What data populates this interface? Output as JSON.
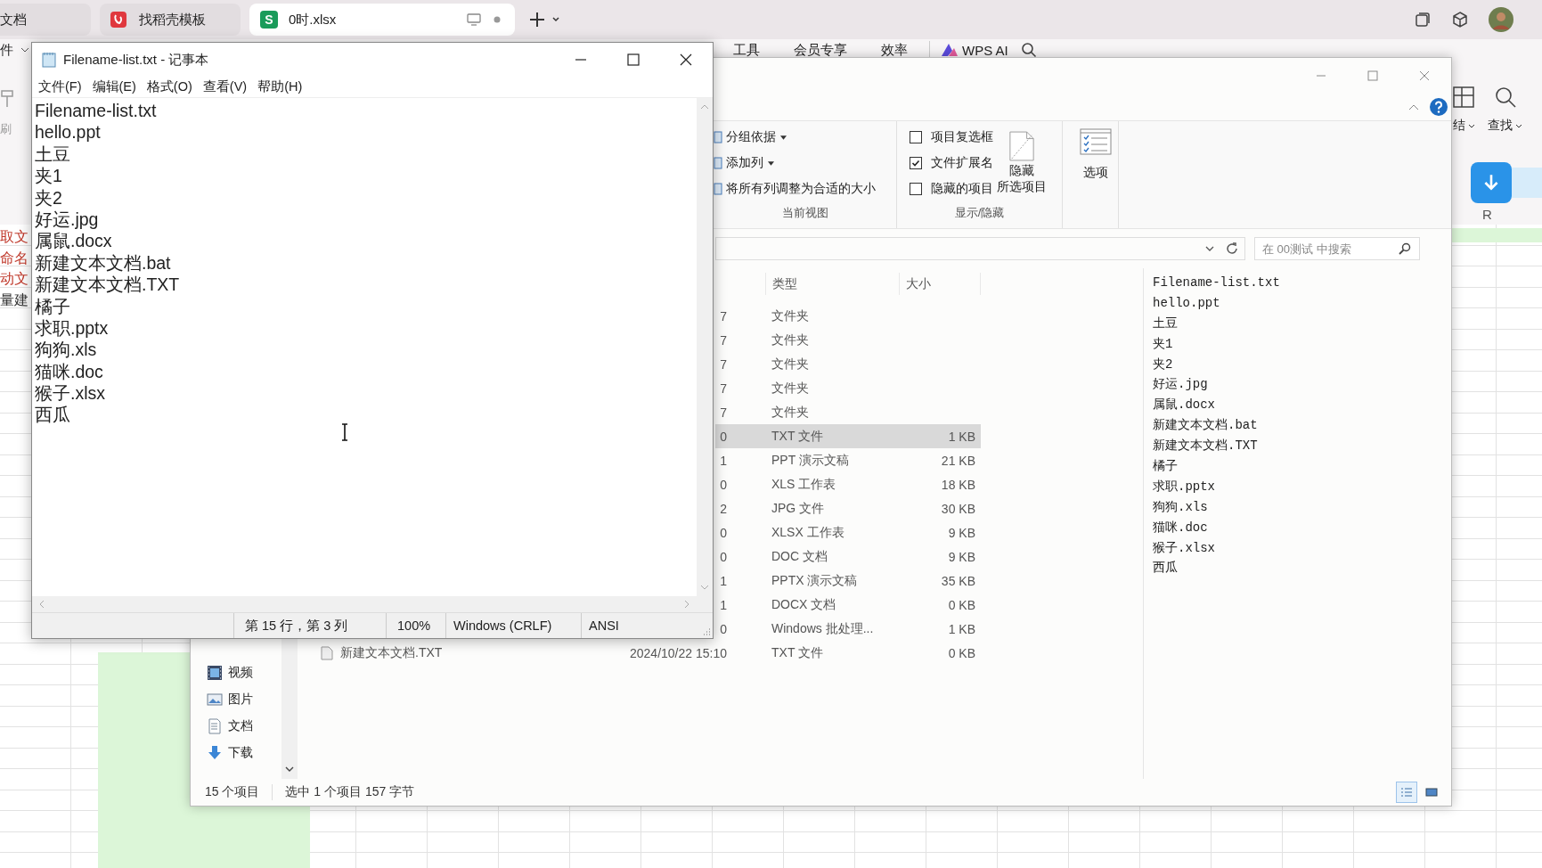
{
  "wps": {
    "tabs": [
      {
        "label": "文档",
        "selected": false,
        "kind": "doc"
      },
      {
        "label": "找稻壳模板",
        "selected": false,
        "kind": "template"
      },
      {
        "label": "0时.xlsx",
        "selected": true,
        "kind": "sheet",
        "icon_text": "S"
      }
    ],
    "menu_cut": "件",
    "menu": [
      "工具",
      "会员专享",
      "效率"
    ],
    "ai_label": "WPS AI",
    "toolbar_left": "刷",
    "toolbar_right": [
      "结",
      "查找"
    ],
    "sheet": {
      "column_header": "R",
      "cells": [
        {
          "text": "取文",
          "color": "#c0392b"
        },
        {
          "text": "命名",
          "color": "#c0392b"
        },
        {
          "text": "动文",
          "color": "#c0392b"
        },
        {
          "text": "量建",
          "color": "#333333"
        }
      ]
    }
  },
  "explorer": {
    "current_view": {
      "label": "当前视图",
      "items": [
        {
          "label": "分组依据",
          "dropdown": true
        },
        {
          "label": "添加列",
          "dropdown": true
        },
        {
          "label": "将所有列调整为合适的大小",
          "dropdown": false
        }
      ]
    },
    "show_hide": {
      "label": "显示/隐藏",
      "checkboxes": [
        {
          "label": "项目复选框",
          "checked": false
        },
        {
          "label": "文件扩展名",
          "checked": true
        },
        {
          "label": "隐藏的项目",
          "checked": false
        }
      ],
      "hide_selected": [
        "隐藏",
        "所选项目"
      ]
    },
    "options": "选项",
    "search": {
      "placeholder": "在 00测试 中搜索"
    },
    "columns": [
      "类型",
      "大小"
    ],
    "rows": [
      {
        "date": "7",
        "type": "文件夹",
        "selected": false
      },
      {
        "date": "7",
        "type": "文件夹",
        "selected": false
      },
      {
        "date": "7",
        "type": "文件夹",
        "selected": false
      },
      {
        "date": "7",
        "type": "文件夹",
        "selected": false
      },
      {
        "date": "7",
        "type": "文件夹",
        "selected": false
      },
      {
        "date": "0",
        "type": "TXT 文件",
        "size": "1 KB",
        "selected": true
      },
      {
        "date": "1",
        "type": "PPT 演示文稿",
        "size": "21 KB",
        "selected": false
      },
      {
        "date": "0",
        "type": "XLS 工作表",
        "size": "18 KB",
        "selected": false
      },
      {
        "date": "2",
        "type": "JPG 文件",
        "size": "30 KB",
        "selected": false
      },
      {
        "date": "0",
        "type": "XLSX 工作表",
        "size": "9 KB",
        "selected": false
      },
      {
        "date": "0",
        "type": "DOC 文档",
        "size": "9 KB",
        "selected": false
      },
      {
        "date": "1",
        "type": "PPTX 演示文稿",
        "size": "35 KB",
        "selected": false
      },
      {
        "date": "1",
        "type": "DOCX 文档",
        "size": "0 KB",
        "selected": false
      },
      {
        "date": "0",
        "type": "Windows 批处理...",
        "size": "1 KB",
        "selected": false
      },
      {
        "name": "新建文本文档.TXT",
        "date": "2024/10/22 15:10",
        "type": "TXT 文件",
        "size": "0 KB",
        "selected": false
      }
    ],
    "preview": [
      "Filename-list.txt",
      "hello.ppt",
      "土豆",
      "夹1",
      "夹2",
      "好运.jpg",
      "属鼠.docx",
      "新建文本文档.bat",
      "新建文本文档.TXT",
      "橘子",
      "求职.pptx",
      "狗狗.xls",
      "猫咪.doc",
      "猴子.xlsx",
      "西瓜"
    ],
    "nav": [
      {
        "label": "视频",
        "kind": "video"
      },
      {
        "label": "图片",
        "kind": "picture"
      },
      {
        "label": "文档",
        "kind": "document"
      },
      {
        "label": "下载",
        "kind": "download"
      }
    ],
    "status": [
      "15 个项目",
      "选中 1 个项目 157 字节"
    ],
    "views": [
      {
        "kind": "details",
        "selected": true
      },
      {
        "kind": "tiles",
        "selected": false
      }
    ]
  },
  "notepad": {
    "title": "Filename-list.txt - 记事本",
    "menu": [
      "文件(F)",
      "编辑(E)",
      "格式(O)",
      "查看(V)",
      "帮助(H)"
    ],
    "lines": [
      "Filename-list.txt",
      "hello.ppt",
      "土豆",
      "夹1",
      "夹2",
      "好运.jpg",
      "属鼠.docx",
      "新建文本文档.bat",
      "新建文本文档.TXT",
      "橘子",
      "求职.pptx",
      "狗狗.xls",
      "猫咪.doc",
      "猴子.xlsx",
      "西瓜"
    ],
    "status": [
      "第 15 行，第 3 列",
      "100%",
      "Windows (CRLF)",
      "ANSI"
    ]
  }
}
